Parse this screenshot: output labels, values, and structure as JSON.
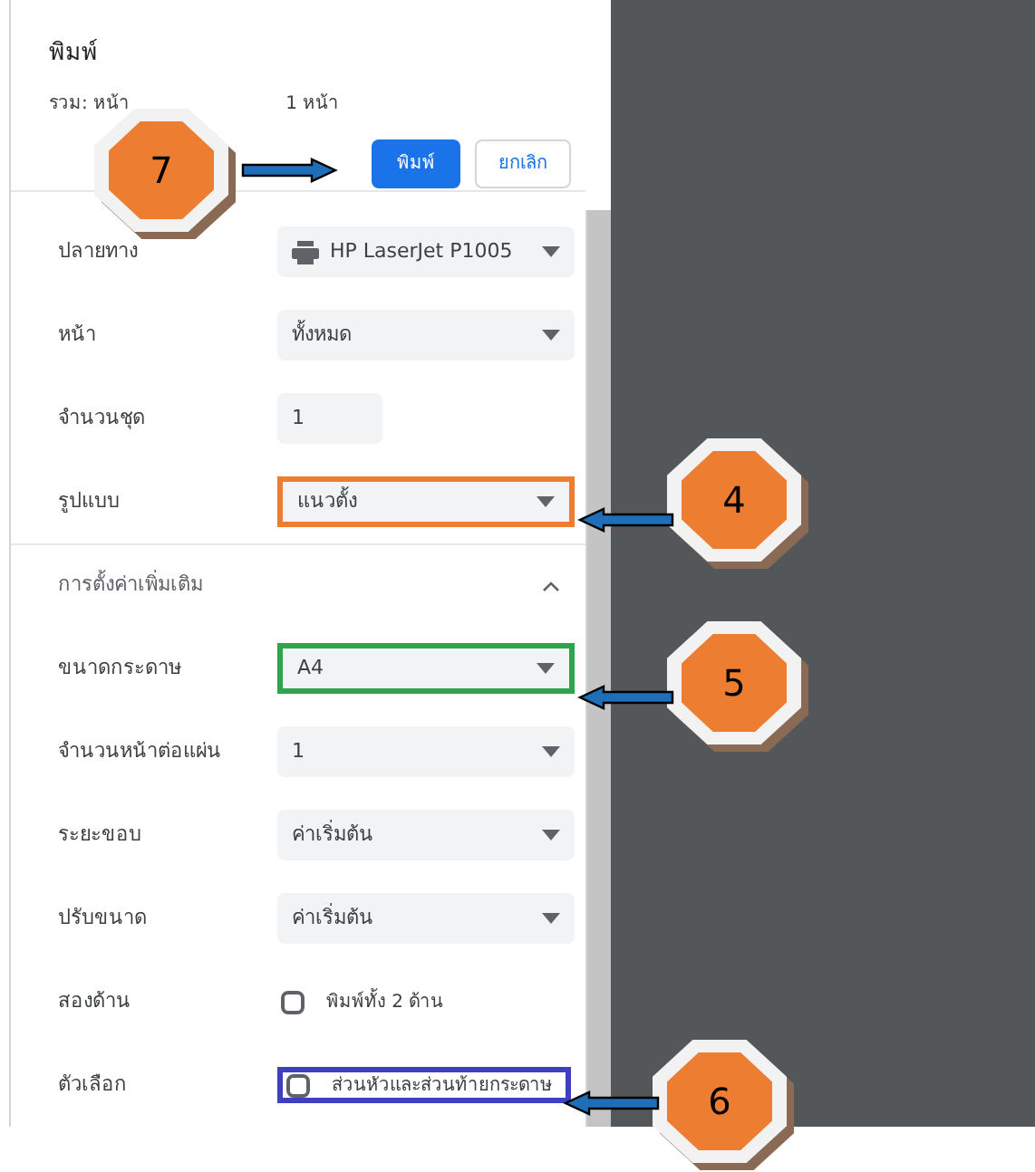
{
  "dialog": {
    "title": "พิมพ์",
    "summary_start": "รวม: หน้า",
    "summary_end": "1 หน้า",
    "buttons": [
      {
        "label": "พิมพ์",
        "kind": "primary"
      },
      {
        "label": "ยกเลิก",
        "kind": "secondary"
      }
    ]
  },
  "settings": [
    {
      "kind": "printer_select",
      "label": "ปลายทาง",
      "value": "HP LaserJet P1005"
    },
    {
      "kind": "select",
      "label": "หน้า",
      "value": "ทั้งหมด"
    },
    {
      "kind": "input",
      "label": "จำนวนชุด",
      "value": "1"
    },
    {
      "kind": "select",
      "label": "รูปแบบ",
      "value": "แนวตั้ง",
      "color": "#ed7d31"
    },
    {
      "kind": "section",
      "label": "การตั้งค่าเพิ่มเติม",
      "expanded": true
    },
    {
      "kind": "select",
      "label": "ขนาดกระดาษ",
      "value": "A4",
      "color": "#2ea44f"
    },
    {
      "kind": "select",
      "label": "จำนวนหน้าต่อแผ่น",
      "value": "1"
    },
    {
      "kind": "select",
      "label": "ระยะขอบ",
      "value": "ค่าเริ่มต้น"
    },
    {
      "kind": "select",
      "label": "ปรับขนาด",
      "value": "ค่าเริ่มต้น"
    },
    {
      "kind": "checkbox",
      "label": "สองด้าน",
      "value": "พิมพ์ทั้ง 2 ด้าน",
      "checked": false
    },
    {
      "kind": "checkbox",
      "label": "ตัวเลือก",
      "value": "ส่วนหัวและส่วนท้ายกระดาษ",
      "checked": false,
      "color": "#3f3fbf"
    }
  ],
  "callouts": [
    {
      "number": "7"
    },
    {
      "number": "4"
    },
    {
      "number": "5"
    },
    {
      "number": "6"
    }
  ]
}
